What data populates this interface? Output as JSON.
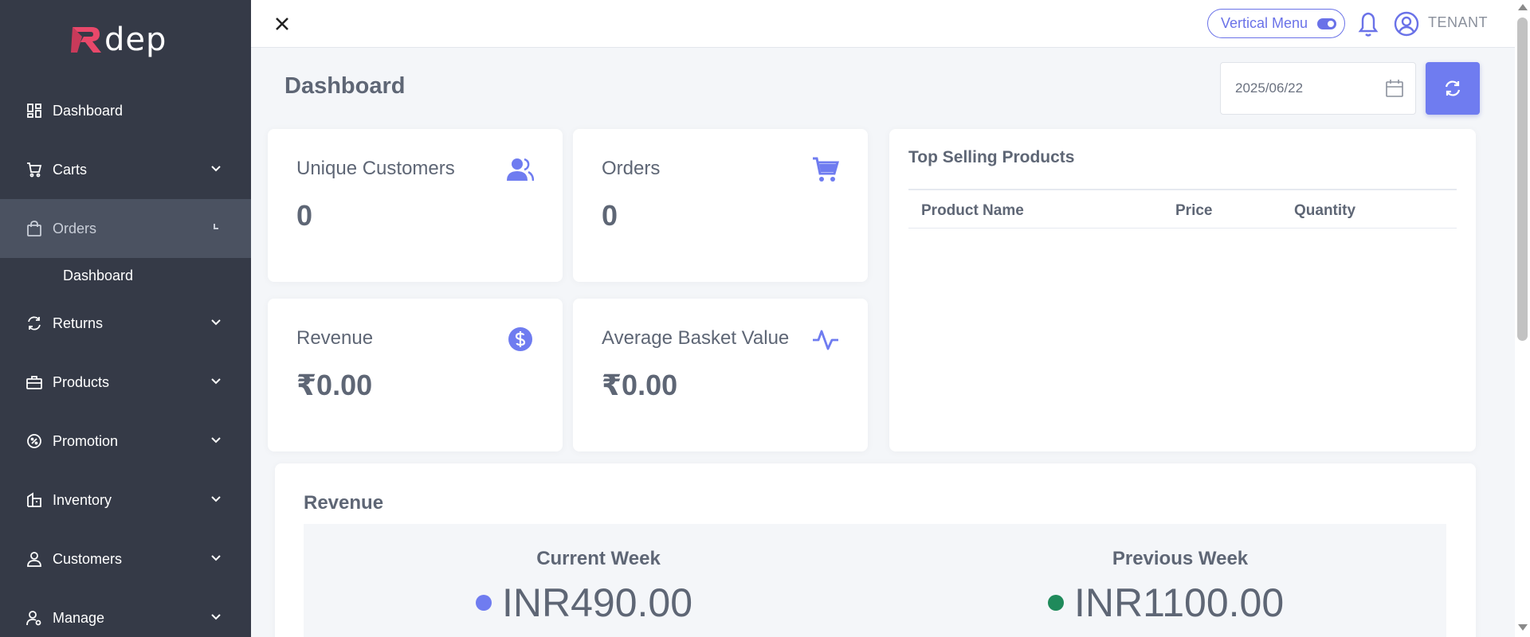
{
  "brand": {
    "name": "dep",
    "accent": "#6a72e8",
    "logo_mark_color": "#e8486a",
    "sidebar_bg": "#353a47"
  },
  "sidebar": {
    "items": [
      {
        "label": "Dashboard",
        "icon": "dashboard-icon",
        "has_chevron": false
      },
      {
        "label": "Carts",
        "icon": "cart-icon",
        "has_chevron": true
      },
      {
        "label": "Orders",
        "icon": "shopping-bag-icon",
        "has_chevron": true,
        "active": true
      },
      {
        "label": "Returns",
        "icon": "refresh-icon",
        "has_chevron": true
      },
      {
        "label": "Products",
        "icon": "briefcase-icon",
        "has_chevron": true
      },
      {
        "label": "Promotion",
        "icon": "badge-percent-icon",
        "has_chevron": true
      },
      {
        "label": "Inventory",
        "icon": "inventory-icon",
        "has_chevron": true
      },
      {
        "label": "Customers",
        "icon": "user-icon",
        "has_chevron": true
      },
      {
        "label": "Manage",
        "icon": "user-gear-icon",
        "has_chevron": true
      }
    ],
    "sub_items": [
      {
        "label": "Dashboard"
      }
    ]
  },
  "topbar": {
    "menu_toggle_label": "Vertical Menu",
    "user_label": "TENANT"
  },
  "main": {
    "title": "Dashboard",
    "date_value": "2025/06/22",
    "stats": [
      {
        "title": "Unique Customers",
        "value": "0",
        "icon": "users-icon"
      },
      {
        "title": "Orders",
        "value": "0",
        "icon": "cart-icon"
      },
      {
        "title": "Revenue",
        "value": "₹0.00",
        "icon": "dollar-circle-icon"
      },
      {
        "title": "Average Basket Value",
        "value": "₹0.00",
        "icon": "activity-icon"
      }
    ],
    "top_selling": {
      "title": "Top Selling Products",
      "columns": [
        "Product Name",
        "Price",
        "Quantity"
      ],
      "rows": []
    },
    "revenue": {
      "title": "Revenue",
      "current_week": {
        "label": "Current Week",
        "value": "INR490.00",
        "color": "#6f7cf0"
      },
      "previous_week": {
        "label": "Previous Week",
        "value": "INR1100.00",
        "color": "#1f8a5b"
      }
    }
  }
}
